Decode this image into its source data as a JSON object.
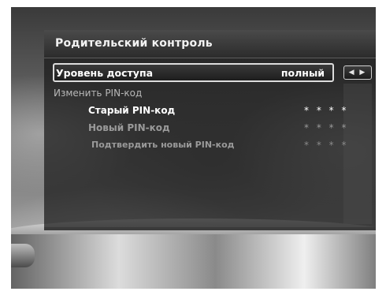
{
  "menu": {
    "title": "Родительский контроль",
    "access_level": {
      "label": "Уровень доступа",
      "value": "полный"
    },
    "change_pin": {
      "label": "Изменить PIN-код"
    },
    "old_pin": {
      "label": "Старый PIN-код",
      "value": "* * * *"
    },
    "new_pin": {
      "label": "Новый PIN-код",
      "value": "* * * *"
    },
    "confirm_pin": {
      "label": "Подтвердить новый PIN-код",
      "value": "* * * *"
    },
    "arrows_glyph": "◀ ▶"
  },
  "colors": {
    "panel_bg": "#191919",
    "header_bg": "#3a3a3a",
    "selected_border": "#dcdcdc",
    "text_active": "#ffffff",
    "text_disabled": "#9a9a9a"
  }
}
